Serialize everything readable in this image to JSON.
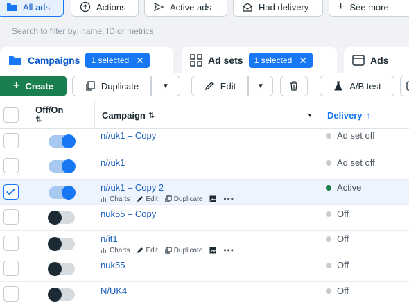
{
  "filters": {
    "all_ads": "All ads",
    "actions": "Actions",
    "active_ads": "Active ads",
    "had_delivery": "Had delivery",
    "see_more": "See more"
  },
  "search": {
    "placeholder": "Search to filter by: name, ID or metrics"
  },
  "tabs": {
    "campaigns": {
      "label": "Campaigns",
      "badge": "1 selected"
    },
    "ad_sets": {
      "label": "Ad sets",
      "badge": "1 selected"
    },
    "ads": {
      "label": "Ads"
    }
  },
  "toolbar": {
    "create": "Create",
    "duplicate": "Duplicate",
    "edit": "Edit",
    "ab_test": "A/B test"
  },
  "table": {
    "headers": {
      "off_on": "Off/On",
      "campaign": "Campaign",
      "delivery": "Delivery"
    },
    "row_actions": {
      "charts": "Charts",
      "edit": "Edit",
      "duplicate": "Duplicate"
    },
    "rows": [
      {
        "name": "n//uk1 – Copy",
        "delivery": "Ad set off",
        "on": true,
        "checked": false
      },
      {
        "name": "n//uk1",
        "delivery": "Ad set off",
        "on": true,
        "checked": false
      },
      {
        "name": "n//uk1 – Copy 2",
        "delivery": "Active",
        "on": true,
        "checked": true
      },
      {
        "name": "nuk55 – Copy",
        "delivery": "Off",
        "on": false,
        "checked": false
      },
      {
        "name": "n/it1",
        "delivery": "Off",
        "on": false,
        "checked": false
      },
      {
        "name": "nuk55",
        "delivery": "Off",
        "on": false,
        "checked": false
      },
      {
        "name": "N/UK4",
        "delivery": "Off",
        "on": false,
        "checked": false
      }
    ]
  },
  "colors": {
    "accent": "#1877f2",
    "create_green": "#1a7f4e",
    "link": "#1c5fba"
  }
}
